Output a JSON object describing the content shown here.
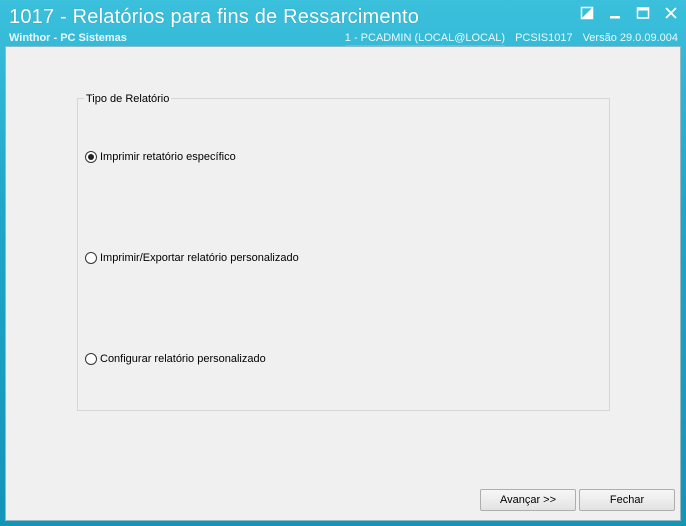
{
  "window": {
    "title": "1017 - Relatórios para fins de Ressarcimento",
    "subtitle": "Winthor - PC Sistemas",
    "session_user": "1 - PCADMIN (LOCAL@LOCAL)",
    "program": "PCSIS1017",
    "version": "Versão  29.0.09.004"
  },
  "group": {
    "legend": "Tipo de Relatório",
    "options": [
      {
        "label": "Imprimir retatório específico",
        "selected": true
      },
      {
        "label": "Imprimir/Exportar relatório personalizado",
        "selected": false
      },
      {
        "label": "Configurar relatório personalizado",
        "selected": false
      }
    ]
  },
  "buttons": {
    "next": "Avançar >>",
    "close": "Fechar"
  }
}
